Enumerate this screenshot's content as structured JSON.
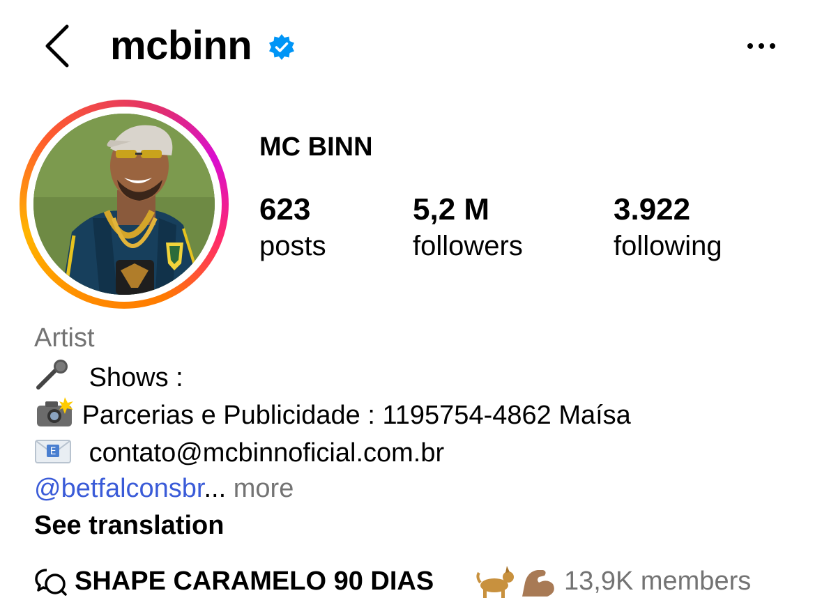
{
  "header": {
    "username": "mcbinn",
    "back_icon": "chevron-left-icon",
    "verified_icon": "verified-badge-icon",
    "more_icon": "ellipsis-icon"
  },
  "profile": {
    "display_name": "MC BINN",
    "avatar_alt": "profile-photo",
    "ring_colors": [
      "#ff8a00",
      "#e1306c",
      "#d90ecf"
    ]
  },
  "stats": {
    "posts_count": "623",
    "posts_label": "posts",
    "followers_count": "5,2 M",
    "followers_label": "followers",
    "following_count": "3.922",
    "following_label": "following"
  },
  "bio": {
    "category": "Artist",
    "line1_emoji": "microphone-icon",
    "line1_text": "Shows :",
    "line2_emoji": "camera-flash-icon",
    "line2_text": "Parcerias e Publicidade : 1195754-4862 Maísa",
    "line3_emoji": "email-icon",
    "line3_text": "contato@mcbinnoficial.com.br",
    "mention": "@betfalconsbr",
    "ellipsis": "...",
    "more_label": "more",
    "translate_label": "See translation"
  },
  "channel": {
    "icon": "broadcast-channel-icon",
    "name": "SHAPE CARAMELO 90 DIAS",
    "emojis": [
      "dog-icon",
      "flexed-biceps-icon"
    ],
    "members": "13,9K members"
  },
  "colors": {
    "text": "#000000",
    "secondary": "#737373",
    "link": "#3a5bd8",
    "verified": "#0095f6"
  }
}
